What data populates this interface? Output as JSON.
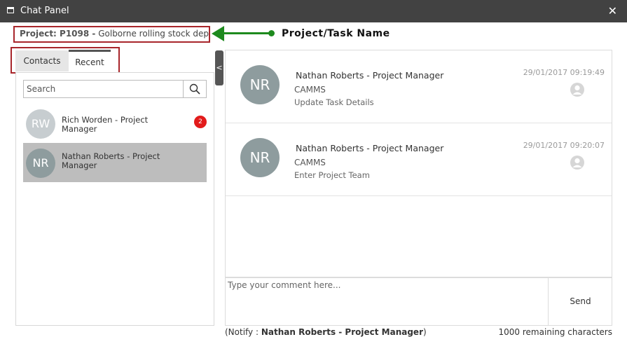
{
  "window": {
    "title": "Chat Panel",
    "close_glyph": "✕"
  },
  "project": {
    "label": "Project: P1098 -",
    "name": "Golborne rolling stock depot"
  },
  "annotation": "Project/Task Name",
  "tabs": [
    {
      "label": "Contacts"
    },
    {
      "label": "Recent"
    }
  ],
  "search": {
    "placeholder": "Search",
    "icon": "search-icon"
  },
  "contacts": [
    {
      "initials": "RW",
      "name": "Rich Worden - Project Manager",
      "badge": "2"
    },
    {
      "initials": "NR",
      "name": "Nathan Roberts - Project Manager"
    }
  ],
  "collapse_glyph": "<",
  "messages": [
    {
      "initials": "NR",
      "name": "Nathan Roberts - Project Manager",
      "org": "CAMMS",
      "action": "Update Task Details",
      "time": "29/01/2017 09:19:49"
    },
    {
      "initials": "NR",
      "name": "Nathan Roberts - Project Manager",
      "org": "CAMMS",
      "action": "Enter Project Team",
      "time": "29/01/2017 09:20:07"
    }
  ],
  "comment": {
    "placeholder": "Type your comment here...",
    "send_label": "Send"
  },
  "notify": {
    "prefix": "(Notify :",
    "name": "Nathan Roberts - Project Manager",
    "suffix": ")"
  },
  "remaining": "1000 remaining characters",
  "colors": {
    "titlebar": "#424242",
    "highlight": "#a8262b",
    "arrow": "#1e8a1e",
    "badge": "#e21b1b"
  }
}
